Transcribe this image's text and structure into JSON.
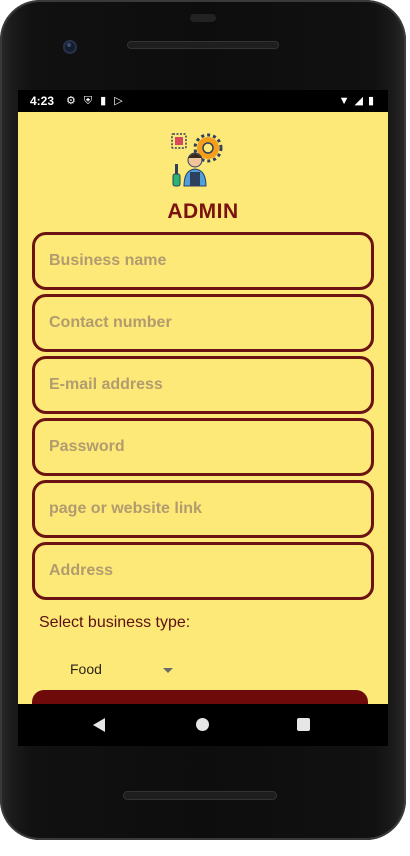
{
  "status_bar": {
    "time": "4:23",
    "left_icons": [
      "gear-icon",
      "shield-icon",
      "sd-card-icon",
      "play-store-icon"
    ],
    "right_icons": [
      "wifi-icon",
      "cell-signal-icon",
      "battery-icon"
    ]
  },
  "app": {
    "title": "ADMIN",
    "logo_icon": "admin-technician-gear-icon",
    "fields": [
      {
        "name": "business-name-field",
        "placeholder": "Business name",
        "value": ""
      },
      {
        "name": "contact-number-field",
        "placeholder": "Contact number",
        "value": ""
      },
      {
        "name": "email-field",
        "placeholder": "E-mail address",
        "value": ""
      },
      {
        "name": "password-field",
        "placeholder": "Password",
        "value": ""
      },
      {
        "name": "website-link-field",
        "placeholder": "page or website link",
        "value": ""
      },
      {
        "name": "address-field",
        "placeholder": "Address",
        "value": ""
      }
    ],
    "business_type_label": "Select business type:",
    "business_type_selected": "Food"
  },
  "colors": {
    "background": "#fde977",
    "accent": "#7b1111",
    "border": "#6b1313",
    "button": "#6e0a0a"
  },
  "nav_bar": {
    "icons": [
      "back-icon",
      "home-icon",
      "recents-icon"
    ]
  }
}
